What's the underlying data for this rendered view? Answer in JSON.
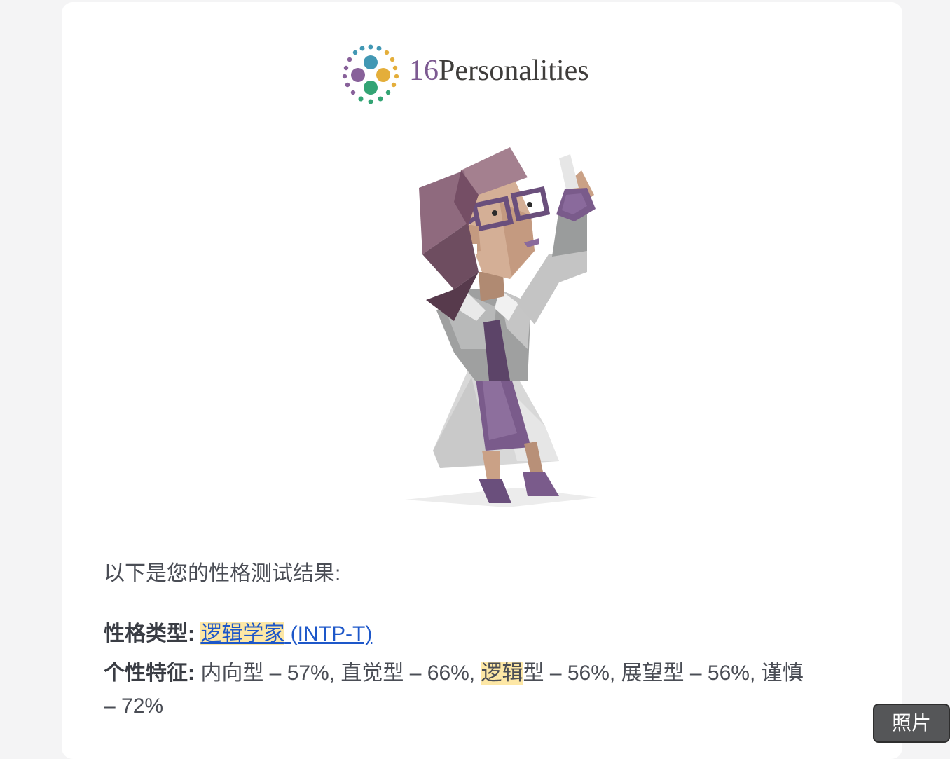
{
  "brand": {
    "logo_number": "16",
    "logo_word": "Personalities",
    "colors": {
      "purple": "#88619a",
      "teal": "#4298b4",
      "yellow": "#e4ae3a",
      "green": "#33a474",
      "text": "#3f3d3b"
    }
  },
  "illustration": {
    "icon": "scientist-woman-illustration"
  },
  "content": {
    "intro": "以下是您的性格测试结果:",
    "type_label": "性格类型:",
    "type_name": "逻辑学家",
    "type_code": " (INTP-T)",
    "traits_label": "个性特征:",
    "traits_part1": " 内向型 – 57%, 直觉型 – 66%, ",
    "traits_highlight": "逻辑",
    "traits_part2": "型 – 56%, 展望型 – 56%, 谨慎",
    "traits_part3": "– 72%"
  },
  "overlay": {
    "photo_button": "照片"
  }
}
